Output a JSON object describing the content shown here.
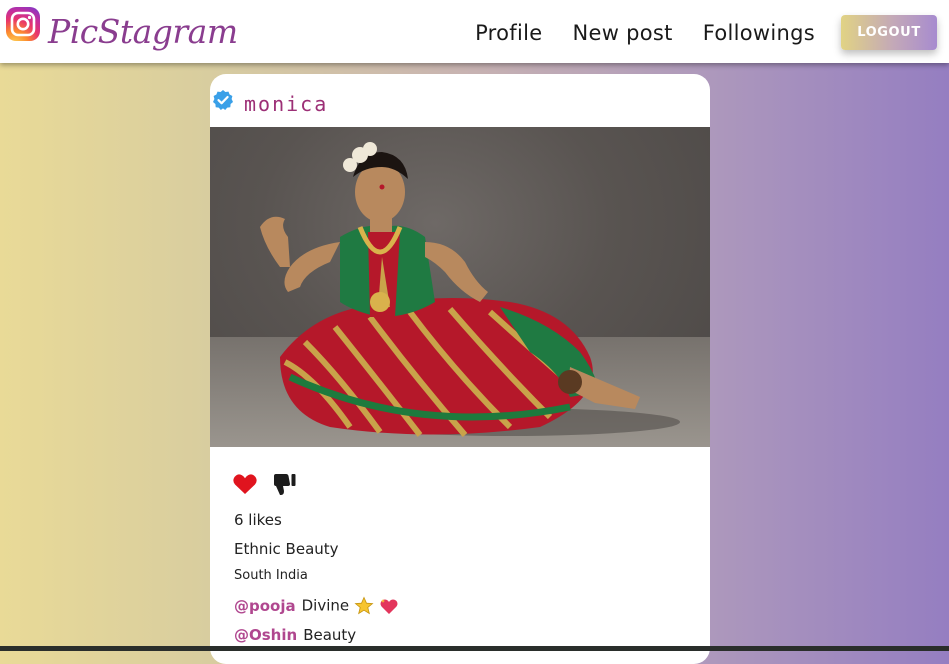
{
  "navbar": {
    "brand": "PicStagram",
    "links": [
      "Profile",
      "New post",
      "Followings"
    ],
    "logout_label": "LOGOUT"
  },
  "post": {
    "username": "monica",
    "verified": true,
    "likes_text": "6 likes",
    "title": "Ethnic Beauty",
    "subtitle": "South India",
    "comments": [
      {
        "user": "@pooja",
        "text": "Divine",
        "emojis": [
          "star-icon",
          "sparkling-heart-icon"
        ]
      },
      {
        "user": "@Oshin",
        "text": "Beauty"
      }
    ],
    "icons": {
      "like": "heart-icon",
      "dislike": "thumbs-down-icon"
    }
  },
  "colors": {
    "brand": "#8a3d8f",
    "username": "#9c2f76",
    "comment_user": "#b0478f",
    "like": "#e0141e",
    "verified": "#3aa0e8",
    "gradient_left": "#e9da97",
    "gradient_right": "#957ec1"
  }
}
